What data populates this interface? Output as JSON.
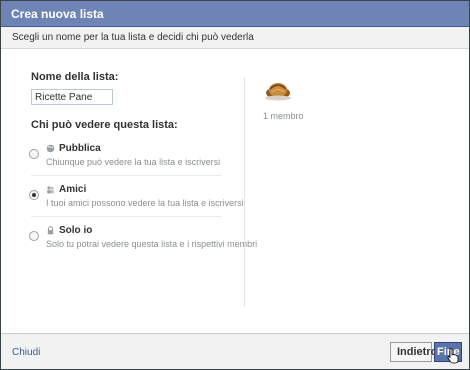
{
  "dialog": {
    "title": "Crea nuova lista",
    "subtitle": "Scegli un nome per la tua lista e decidi chi può vederla"
  },
  "form": {
    "name_label": "Nome della lista:",
    "name_value": "Ricette Pane",
    "who_label": "Chi può vedere questa lista:",
    "options": [
      {
        "title": "Pubblica",
        "desc": "Chiunque può vedere la tua lista e iscriversi",
        "icon": "globe-icon",
        "checked": false
      },
      {
        "title": "Amici",
        "desc": "I tuoi amici possono vedere la tua lista e iscriversi",
        "icon": "friends-icon",
        "checked": true
      },
      {
        "title": "Solo io",
        "desc": "Solo tu potrai vedere questa lista e i rispettivi membri",
        "icon": "lock-icon",
        "checked": false
      }
    ]
  },
  "members": {
    "count_text": "1 membro"
  },
  "footer": {
    "close_label": "Chiudi",
    "back_label": "Indietro",
    "done_label": "Fine"
  },
  "colors": {
    "title_bar": "#6d84b4",
    "primary_button": "#5b74a8",
    "link": "#3b5998"
  }
}
